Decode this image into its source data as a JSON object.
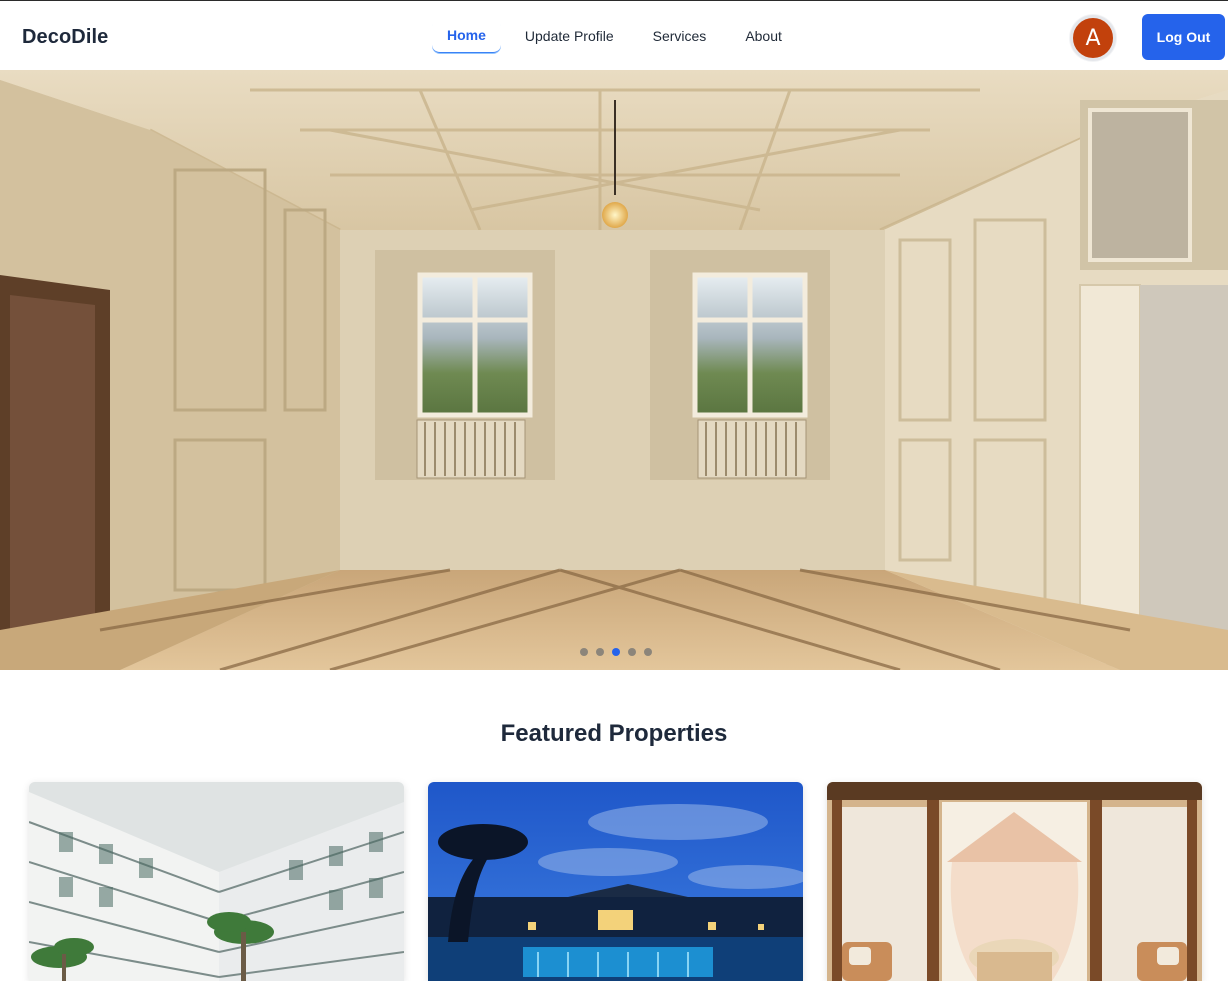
{
  "navbar": {
    "brand": "DecoDile",
    "links": [
      {
        "label": "Home",
        "active": true
      },
      {
        "label": "Update Profile",
        "active": false
      },
      {
        "label": "Services",
        "active": false
      },
      {
        "label": "About",
        "active": false
      }
    ],
    "avatar_initial": "A",
    "avatar_color": "#c2410c",
    "logout_label": "Log Out",
    "accent_color": "#2563eb"
  },
  "hero": {
    "image": "room-interior-photo",
    "slides_count": 5,
    "active_slide": 3
  },
  "featured": {
    "title": "Featured Properties",
    "cards": [
      {
        "image": "hotel-courtyard-photo"
      },
      {
        "image": "pool-resort-photo"
      },
      {
        "image": "canopy-bedroom-photo"
      }
    ]
  }
}
